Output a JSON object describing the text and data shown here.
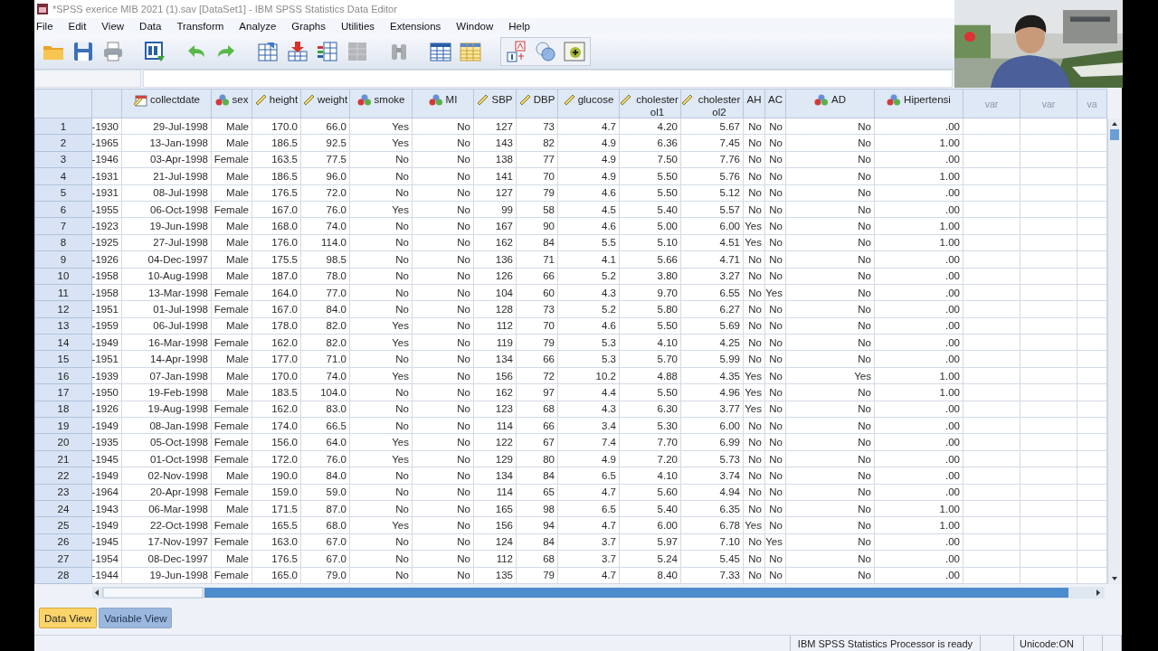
{
  "window": {
    "title": "*SPSS exerice MIB 2021 (1).sav [DataSet1] - IBM SPSS Statistics Data Editor"
  },
  "menu": [
    "File",
    "Edit",
    "View",
    "Data",
    "Transform",
    "Analyze",
    "Graphs",
    "Utilities",
    "Extensions",
    "Window",
    "Help"
  ],
  "columns": [
    {
      "kind": "plain"
    },
    {
      "label": "collectdate",
      "kind": "date"
    },
    {
      "label": "sex",
      "kind": "nominal"
    },
    {
      "label": "height",
      "kind": "scale"
    },
    {
      "label": "weight",
      "kind": "scale"
    },
    {
      "label": "smoke",
      "kind": "nominal"
    },
    {
      "label": "MI",
      "kind": "nominal"
    },
    {
      "label": "SBP",
      "kind": "scale"
    },
    {
      "label": "DBP",
      "kind": "scale"
    },
    {
      "label": "glucose",
      "kind": "scale"
    },
    {
      "label": "cholesterol1",
      "kind": "scale"
    },
    {
      "label": "cholesterol2",
      "kind": "scale"
    },
    {
      "label": "AH",
      "kind": "plain"
    },
    {
      "label": "AC",
      "kind": "plain"
    },
    {
      "label": "AD",
      "kind": "nominal"
    },
    {
      "label": "Hipertensi",
      "kind": "nominal"
    },
    {
      "label": "var",
      "kind": "empty"
    },
    {
      "label": "var",
      "kind": "empty"
    },
    {
      "label": "va",
      "kind": "empty"
    }
  ],
  "rows": [
    {
      "number": "1",
      "cells": [
        "-1930",
        "29-Jul-1998",
        "Male",
        "170.0",
        "66.0",
        "Yes",
        "No",
        "127",
        "73",
        "4.7",
        "4.20",
        "5.67",
        "No",
        "No",
        "No",
        ".00"
      ]
    },
    {
      "number": "2",
      "cells": [
        "-1965",
        "13-Jan-1998",
        "Male",
        "186.5",
        "92.5",
        "Yes",
        "No",
        "143",
        "82",
        "4.9",
        "6.36",
        "7.45",
        "No",
        "No",
        "No",
        "1.00"
      ]
    },
    {
      "number": "3",
      "cells": [
        "-1946",
        "03-Apr-1998",
        "Female",
        "163.5",
        "77.5",
        "No",
        "No",
        "138",
        "77",
        "4.9",
        "7.50",
        "7.76",
        "No",
        "No",
        "No",
        ".00"
      ]
    },
    {
      "number": "4",
      "cells": [
        "-1931",
        "21-Jul-1998",
        "Male",
        "186.5",
        "96.0",
        "No",
        "No",
        "141",
        "70",
        "4.9",
        "5.50",
        "5.76",
        "No",
        "No",
        "No",
        "1.00"
      ]
    },
    {
      "number": "5",
      "cells": [
        "-1931",
        "08-Jul-1998",
        "Male",
        "176.5",
        "72.0",
        "No",
        "No",
        "127",
        "79",
        "4.6",
        "5.50",
        "5.12",
        "No",
        "No",
        "No",
        ".00"
      ]
    },
    {
      "number": "6",
      "cells": [
        "-1955",
        "06-Oct-1998",
        "Female",
        "167.0",
        "76.0",
        "Yes",
        "No",
        "99",
        "58",
        "4.5",
        "5.40",
        "5.57",
        "No",
        "No",
        "No",
        ".00"
      ]
    },
    {
      "number": "7",
      "cells": [
        "-1923",
        "19-Jun-1998",
        "Male",
        "168.0",
        "74.0",
        "No",
        "No",
        "167",
        "90",
        "4.6",
        "5.00",
        "6.00",
        "Yes",
        "No",
        "No",
        "1.00"
      ]
    },
    {
      "number": "8",
      "cells": [
        "-1925",
        "27-Jul-1998",
        "Male",
        "176.0",
        "114.0",
        "No",
        "No",
        "162",
        "84",
        "5.5",
        "5.10",
        "4.51",
        "Yes",
        "No",
        "No",
        "1.00"
      ]
    },
    {
      "number": "9",
      "cells": [
        "-1926",
        "04-Dec-1997",
        "Male",
        "175.5",
        "98.5",
        "No",
        "No",
        "136",
        "71",
        "4.1",
        "5.66",
        "4.71",
        "No",
        "No",
        "No",
        ".00"
      ]
    },
    {
      "number": "10",
      "cells": [
        "-1958",
        "10-Aug-1998",
        "Male",
        "187.0",
        "78.0",
        "No",
        "No",
        "126",
        "66",
        "5.2",
        "3.80",
        "3.27",
        "No",
        "No",
        "No",
        ".00"
      ]
    },
    {
      "number": "11",
      "cells": [
        "-1958",
        "13-Mar-1998",
        "Female",
        "164.0",
        "77.0",
        "No",
        "No",
        "104",
        "60",
        "4.3",
        "9.70",
        "6.55",
        "No",
        "Yes",
        "No",
        ".00"
      ]
    },
    {
      "number": "12",
      "cells": [
        "-1951",
        "01-Jul-1998",
        "Female",
        "167.0",
        "84.0",
        "No",
        "No",
        "128",
        "73",
        "5.2",
        "5.80",
        "6.27",
        "No",
        "No",
        "No",
        ".00"
      ]
    },
    {
      "number": "13",
      "cells": [
        "-1959",
        "06-Jul-1998",
        "Male",
        "178.0",
        "82.0",
        "Yes",
        "No",
        "112",
        "70",
        "4.6",
        "5.50",
        "5.69",
        "No",
        "No",
        "No",
        ".00"
      ]
    },
    {
      "number": "14",
      "cells": [
        "-1949",
        "16-Mar-1998",
        "Female",
        "162.0",
        "82.0",
        "Yes",
        "No",
        "119",
        "79",
        "5.3",
        "4.10",
        "4.25",
        "No",
        "No",
        "No",
        ".00"
      ]
    },
    {
      "number": "15",
      "cells": [
        "-1951",
        "14-Apr-1998",
        "Male",
        "177.0",
        "71.0",
        "No",
        "No",
        "134",
        "66",
        "5.3",
        "5.70",
        "5.99",
        "No",
        "No",
        "No",
        ".00"
      ]
    },
    {
      "number": "16",
      "cells": [
        "-1939",
        "07-Jan-1998",
        "Male",
        "170.0",
        "74.0",
        "Yes",
        "No",
        "156",
        "72",
        "10.2",
        "4.88",
        "4.35",
        "Yes",
        "No",
        "Yes",
        "1.00"
      ]
    },
    {
      "number": "17",
      "cells": [
        "-1950",
        "19-Feb-1998",
        "Male",
        "183.5",
        "104.0",
        "No",
        "No",
        "162",
        "97",
        "4.4",
        "5.50",
        "4.96",
        "Yes",
        "No",
        "No",
        "1.00"
      ]
    },
    {
      "number": "18",
      "cells": [
        "-1926",
        "19-Aug-1998",
        "Female",
        "162.0",
        "83.0",
        "No",
        "No",
        "123",
        "68",
        "4.3",
        "6.30",
        "3.77",
        "Yes",
        "No",
        "No",
        ".00"
      ]
    },
    {
      "number": "19",
      "cells": [
        "-1949",
        "08-Jan-1998",
        "Female",
        "174.0",
        "66.5",
        "No",
        "No",
        "114",
        "66",
        "3.4",
        "5.30",
        "6.00",
        "No",
        "No",
        "No",
        ".00"
      ]
    },
    {
      "number": "20",
      "cells": [
        "-1935",
        "05-Oct-1998",
        "Female",
        "156.0",
        "64.0",
        "Yes",
        "No",
        "122",
        "67",
        "7.4",
        "7.70",
        "6.99",
        "No",
        "No",
        "No",
        ".00"
      ]
    },
    {
      "number": "21",
      "cells": [
        "-1945",
        "01-Oct-1998",
        "Female",
        "172.0",
        "76.0",
        "Yes",
        "No",
        "129",
        "80",
        "4.9",
        "7.20",
        "5.73",
        "No",
        "No",
        "No",
        ".00"
      ]
    },
    {
      "number": "22",
      "cells": [
        "-1949",
        "02-Nov-1998",
        "Male",
        "190.0",
        "84.0",
        "No",
        "No",
        "134",
        "84",
        "6.5",
        "4.10",
        "3.74",
        "No",
        "No",
        "No",
        ".00"
      ]
    },
    {
      "number": "23",
      "cells": [
        "-1964",
        "20-Apr-1998",
        "Female",
        "159.0",
        "59.0",
        "No",
        "No",
        "114",
        "65",
        "4.7",
        "5.60",
        "4.94",
        "No",
        "No",
        "No",
        ".00"
      ]
    },
    {
      "number": "24",
      "cells": [
        "-1943",
        "06-Mar-1998",
        "Male",
        "171.5",
        "87.0",
        "No",
        "No",
        "165",
        "98",
        "6.5",
        "5.40",
        "6.35",
        "No",
        "No",
        "No",
        "1.00"
      ]
    },
    {
      "number": "25",
      "cells": [
        "-1949",
        "22-Oct-1998",
        "Female",
        "165.5",
        "68.0",
        "Yes",
        "No",
        "156",
        "94",
        "4.7",
        "6.00",
        "6.78",
        "Yes",
        "No",
        "No",
        "1.00"
      ]
    },
    {
      "number": "26",
      "cells": [
        "-1945",
        "17-Nov-1997",
        "Female",
        "163.0",
        "67.0",
        "No",
        "No",
        "124",
        "84",
        "3.7",
        "5.97",
        "7.10",
        "No",
        "Yes",
        "No",
        ".00"
      ]
    },
    {
      "number": "27",
      "cells": [
        "-1954",
        "08-Dec-1997",
        "Male",
        "176.5",
        "67.0",
        "No",
        "No",
        "112",
        "68",
        "3.7",
        "5.24",
        "5.45",
        "No",
        "No",
        "No",
        ".00"
      ]
    },
    {
      "number": "28",
      "cells": [
        "-1944",
        "19-Jun-1998",
        "Female",
        "165.0",
        "79.0",
        "No",
        "No",
        "135",
        "79",
        "4.7",
        "8.40",
        "7.33",
        "No",
        "No",
        "No",
        ".00"
      ]
    }
  ],
  "tabs": [
    {
      "label": "Data View",
      "selected": true
    },
    {
      "label": "Variable View",
      "selected": false
    }
  ],
  "status_bar": {
    "message": "IBM SPSS Statistics Processor is ready",
    "encoding": "Unicode:ON"
  }
}
